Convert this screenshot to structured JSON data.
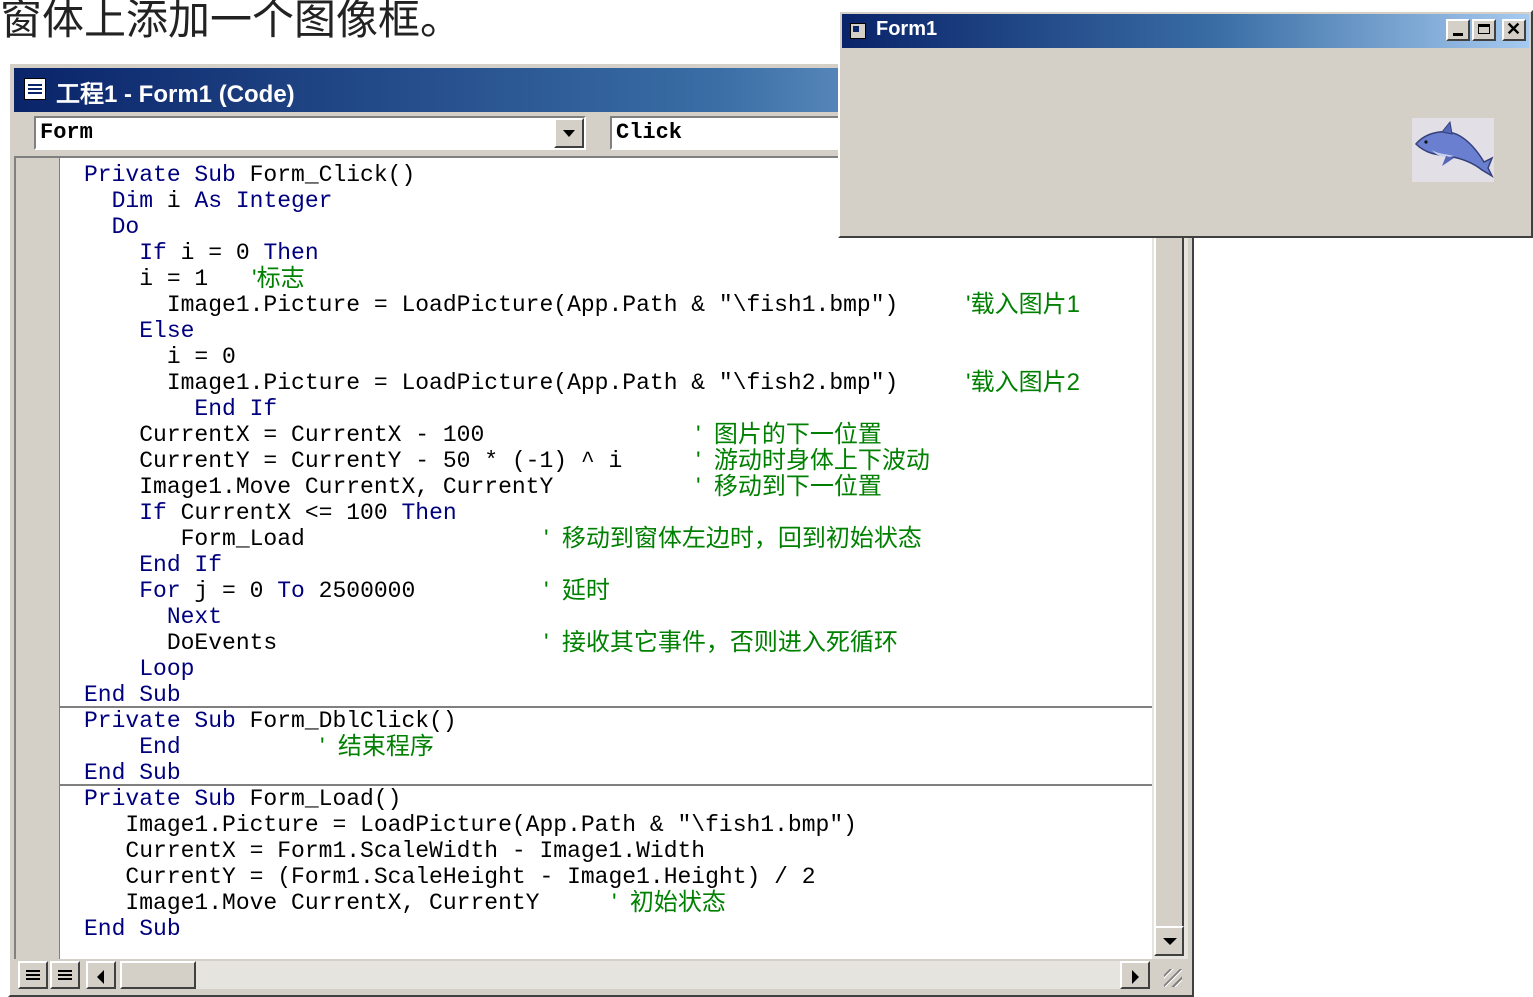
{
  "document": {
    "caption": "窗体上添加一个图像框。"
  },
  "code_window": {
    "title": "工程1 - Form1 (Code)",
    "object_combo": "Form",
    "procedure_combo": "Click",
    "code_lines": [
      {
        "segments": [
          {
            "t": "Private Sub",
            "k": 1
          },
          {
            "t": " Form_Click()"
          }
        ]
      },
      {
        "segments": [
          {
            "t": "  Dim",
            "k": 1
          },
          {
            "t": " i "
          },
          {
            "t": "As Integer",
            "k": 1
          }
        ]
      },
      {
        "segments": [
          {
            "t": "  Do",
            "k": 1
          }
        ]
      },
      {
        "segments": [
          {
            "t": "    If",
            "k": 1
          },
          {
            "t": " i = 0 "
          },
          {
            "t": "Then",
            "k": 1
          }
        ]
      },
      {
        "segments": [
          {
            "t": "    i = 1  "
          }
        ]
      },
      {
        "segments": [
          {
            "t": "      Image1.Picture = LoadPicture(App.Path & \"\\fish1.bmp\")"
          }
        ]
      },
      {
        "segments": [
          {
            "t": "    Else",
            "k": 1
          }
        ]
      },
      {
        "segments": [
          {
            "t": "      i = 0"
          }
        ]
      },
      {
        "segments": [
          {
            "t": "      Image1.Picture = LoadPicture(App.Path & \"\\fish2.bmp\")"
          }
        ]
      },
      {
        "segments": [
          {
            "t": "        End If",
            "k": 1
          }
        ]
      },
      {
        "segments": [
          {
            "t": "    CurrentX = CurrentX - 100"
          }
        ]
      },
      {
        "segments": [
          {
            "t": "    CurrentY = CurrentY - 50 * (-1) ^ i"
          }
        ]
      },
      {
        "segments": [
          {
            "t": "    Image1.Move CurrentX, CurrentY"
          }
        ]
      },
      {
        "segments": [
          {
            "t": "    If",
            "k": 1
          },
          {
            "t": " CurrentX <= 100 "
          },
          {
            "t": "Then",
            "k": 1
          }
        ]
      },
      {
        "segments": [
          {
            "t": "       Form_Load"
          }
        ]
      },
      {
        "segments": [
          {
            "t": "    End If",
            "k": 1
          }
        ]
      },
      {
        "segments": [
          {
            "t": "    For",
            "k": 1
          },
          {
            "t": " j = 0 "
          },
          {
            "t": "To",
            "k": 1
          },
          {
            "t": " 2500000"
          }
        ]
      },
      {
        "segments": [
          {
            "t": "      Next",
            "k": 1
          }
        ]
      },
      {
        "segments": [
          {
            "t": "      DoEvents"
          }
        ]
      },
      {
        "segments": [
          {
            "t": "    Loop",
            "k": 1
          }
        ]
      },
      {
        "segments": [
          {
            "t": "End Sub",
            "k": 1
          }
        ]
      },
      {
        "segments": [
          {
            "t": "Private Sub",
            "k": 1
          },
          {
            "t": " Form_DblClick()"
          }
        ]
      },
      {
        "segments": [
          {
            "t": "    End",
            "k": 1
          }
        ]
      },
      {
        "segments": [
          {
            "t": "End Sub",
            "k": 1
          }
        ]
      },
      {
        "segments": [
          {
            "t": "Private Sub",
            "k": 1
          },
          {
            "t": " Form_Load()"
          }
        ]
      },
      {
        "segments": [
          {
            "t": "   Image1.Picture = LoadPicture(App.Path & \"\\fish1.bmp\")"
          }
        ]
      },
      {
        "segments": [
          {
            "t": "   CurrentX = Form1.ScaleWidth - Image1.Width"
          }
        ]
      },
      {
        "segments": [
          {
            "t": "   CurrentY = (Form1.ScaleHeight - Image1.Height) / 2"
          }
        ]
      },
      {
        "segments": [
          {
            "t": "   Image1.Move CurrentX, CurrentY"
          }
        ]
      },
      {
        "segments": [
          {
            "t": "End Sub",
            "k": 1
          }
        ]
      }
    ],
    "comments": [
      {
        "line": 4,
        "text": "'标志"
      },
      {
        "line": 5,
        "text": "'载入图片1"
      },
      {
        "line": 8,
        "text": "'载入图片2"
      },
      {
        "line": 10,
        "text": "'  图片的下一位置"
      },
      {
        "line": 11,
        "text": "'  游动时身体上下波动"
      },
      {
        "line": 12,
        "text": "'  移动到下一位置"
      },
      {
        "line": 14,
        "text": "'  移动到窗体左边时，回到初始状态"
      },
      {
        "line": 16,
        "text": "'  延时"
      },
      {
        "line": 18,
        "text": "'  接收其它事件，否则进入死循环"
      },
      {
        "line": 22,
        "text": "'  结束程序"
      },
      {
        "line": 28,
        "text": "'  初始状态"
      }
    ]
  },
  "form_window": {
    "title": "Form1",
    "minimize_label": "_",
    "maximize_label": "□",
    "close_label": "×",
    "image_label": "fish image"
  }
}
